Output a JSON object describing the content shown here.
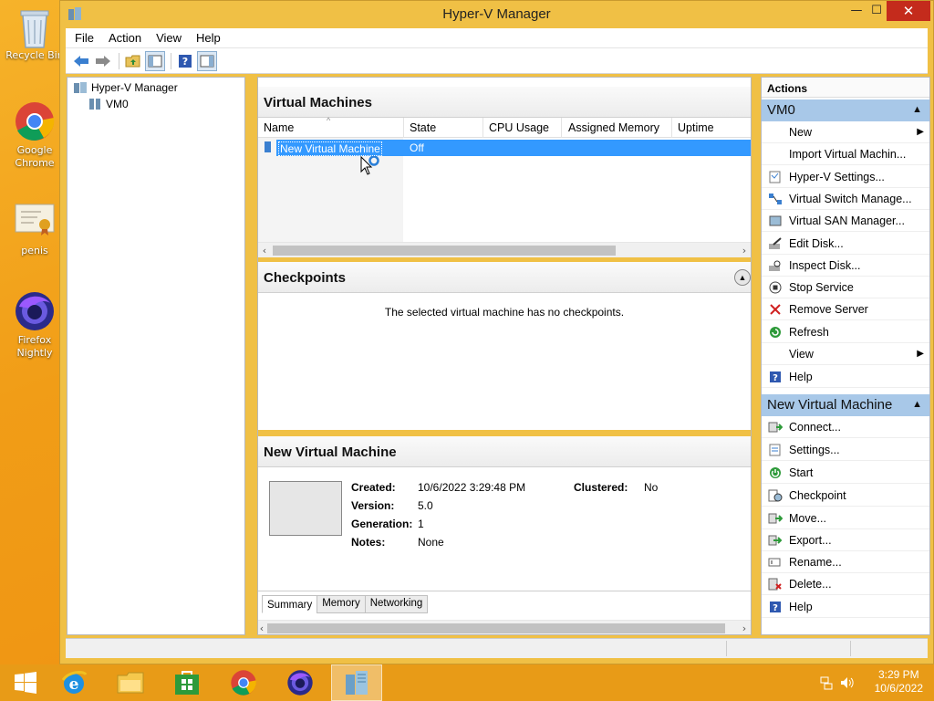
{
  "desktop": {
    "icons": [
      {
        "label": "Recycle Bin"
      },
      {
        "label": "Google Chrome"
      },
      {
        "label": "penis"
      },
      {
        "label": "Firefox Nightly"
      }
    ]
  },
  "window": {
    "title": "Hyper-V Manager",
    "minimize": "—",
    "maximize": "☐",
    "close": "✕"
  },
  "menu": [
    "File",
    "Action",
    "View",
    "Help"
  ],
  "tree": {
    "root": "Hyper-V Manager",
    "child": "VM0"
  },
  "virtual_machines": {
    "title": "Virtual Machines",
    "columns": [
      "Name",
      "State",
      "CPU Usage",
      "Assigned Memory",
      "Uptime"
    ],
    "rows": [
      {
        "name": "New Virtual Machine",
        "state": "Off"
      }
    ]
  },
  "checkpoints": {
    "title": "Checkpoints",
    "message": "The selected virtual machine has no checkpoints."
  },
  "details": {
    "title": "New Virtual Machine",
    "created_label": "Created:",
    "created_value": "10/6/2022 3:29:48 PM",
    "version_label": "Version:",
    "version_value": "5.0",
    "generation_label": "Generation:",
    "generation_value": "1",
    "notes_label": "Notes:",
    "notes_value": "None",
    "clustered_label": "Clustered:",
    "clustered_value": "No",
    "tabs": [
      "Summary",
      "Memory",
      "Networking"
    ]
  },
  "actions": {
    "title": "Actions",
    "group1": {
      "label": "VM0",
      "items": [
        "New",
        "Import Virtual Machin...",
        "Hyper-V Settings...",
        "Virtual Switch Manage...",
        "Virtual SAN Manager...",
        "Edit Disk...",
        "Inspect Disk...",
        "Stop Service",
        "Remove Server",
        "Refresh",
        "View",
        "Help"
      ]
    },
    "group2": {
      "label": "New Virtual Machine",
      "items": [
        "Connect...",
        "Settings...",
        "Start",
        "Checkpoint",
        "Move...",
        "Export...",
        "Rename...",
        "Delete...",
        "Help"
      ]
    }
  },
  "clock": {
    "time": "3:29 PM",
    "date": "10/6/2022"
  },
  "colors": {
    "desktop": "#f19d17",
    "window_frame": "#f0c045",
    "selection": "#3399ff",
    "action_group": "#a8c8e8"
  }
}
